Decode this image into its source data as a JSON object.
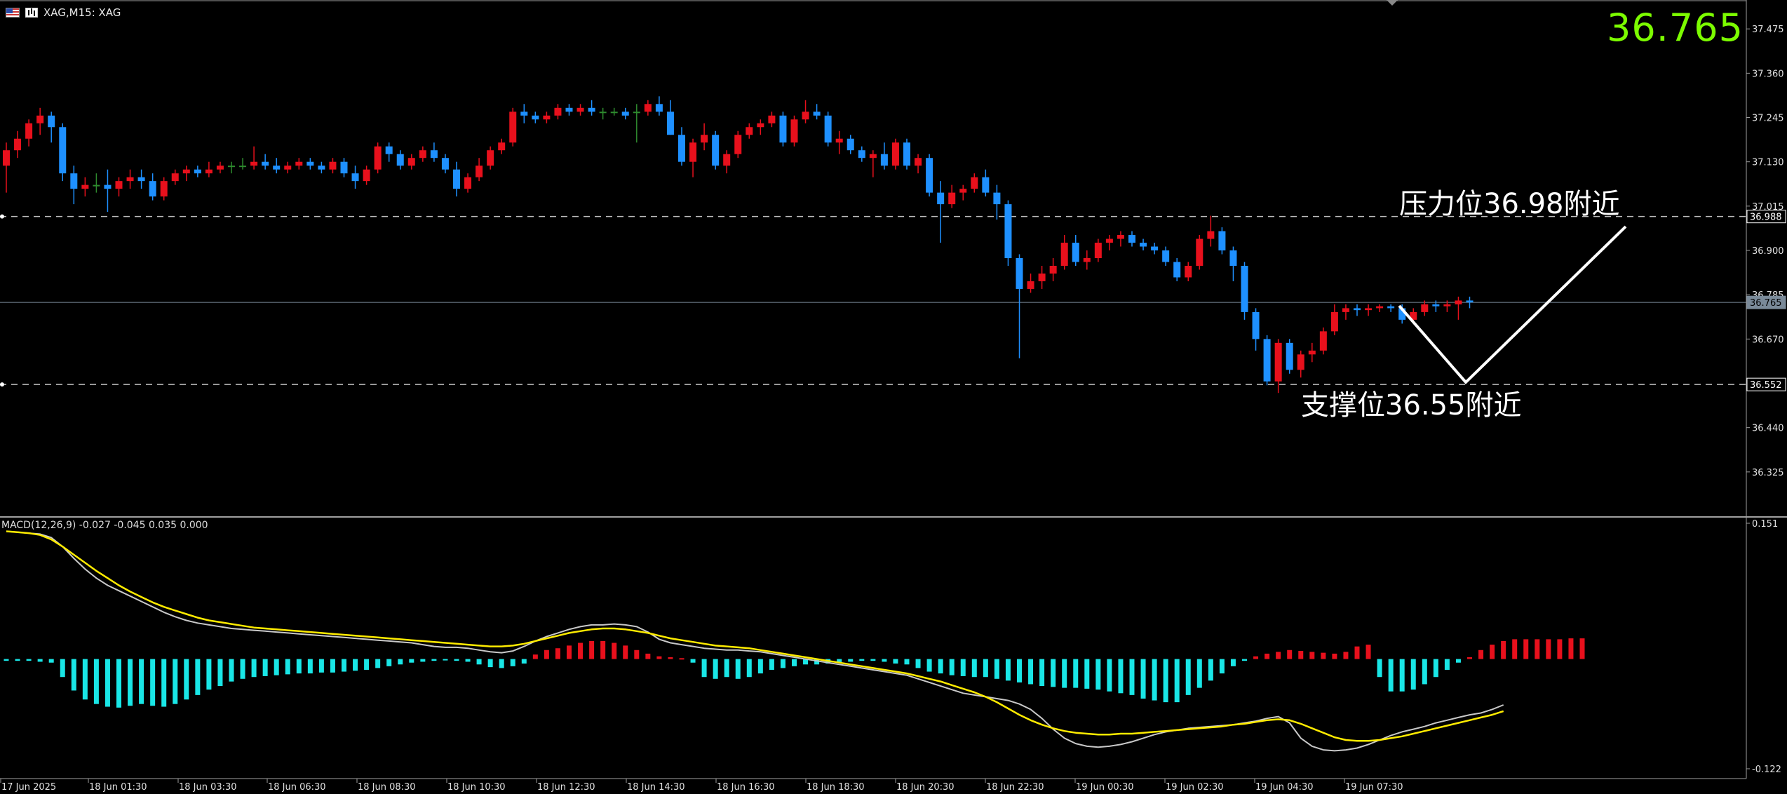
{
  "window": {
    "symbol_label": "XAG,M15:  XAG",
    "last_price": "36.765"
  },
  "annotations": {
    "resistance": "压力位36.98附近",
    "support": "支撑位36.55附近"
  },
  "colors": {
    "background": "#000000",
    "bull_candle": "#e8101c",
    "bear_candle": "#1e90ff",
    "neutral_candle": "#2e8b2e",
    "grid_dash": "#bfbfbf",
    "last_price_line": "#7a8a99",
    "macd_line": "#c8c8c8",
    "signal_line": "#ffeb00",
    "hist_positive": "#e8101c",
    "hist_negative": "#19e6e6",
    "last_price_text": "#7cfc00"
  },
  "chart_data": [
    {
      "type": "candlestick",
      "timeframe": "M15",
      "ylim": [
        36.21,
        37.55
      ],
      "y_ticks": [
        "37.475",
        "37.360",
        "37.245",
        "37.130",
        "37.015",
        "36.900",
        "36.785",
        "36.670",
        "36.555",
        "36.440",
        "36.325"
      ],
      "x_ticks": [
        "17 Jun 2025",
        "18 Jun 01:30",
        "18 Jun 03:30",
        "18 Jun 06:30",
        "18 Jun 08:30",
        "18 Jun 10:30",
        "18 Jun 12:30",
        "18 Jun 14:30",
        "18 Jun 16:30",
        "18 Jun 18:30",
        "18 Jun 20:30",
        "18 Jun 22:30",
        "19 Jun 00:30",
        "19 Jun 02:30",
        "19 Jun 04:30",
        "19 Jun 07:30"
      ],
      "price_labels": {
        "resistance": "36.988",
        "current": "36.765",
        "support": "36.552"
      },
      "levels": {
        "resistance": 36.988,
        "current": 36.765,
        "support": 36.552
      },
      "ohlc": [
        [
          37.12,
          37.18,
          37.05,
          37.16
        ],
        [
          37.16,
          37.21,
          37.14,
          37.19
        ],
        [
          37.19,
          37.24,
          37.17,
          37.23
        ],
        [
          37.23,
          37.27,
          37.2,
          37.25
        ],
        [
          37.25,
          37.26,
          37.18,
          37.22
        ],
        [
          37.22,
          37.23,
          37.08,
          37.1
        ],
        [
          37.1,
          37.12,
          37.02,
          37.06
        ],
        [
          37.06,
          37.09,
          37.04,
          37.07
        ],
        [
          37.07,
          37.1,
          37.05,
          37.07
        ],
        [
          37.07,
          37.11,
          37.0,
          37.06
        ],
        [
          37.06,
          37.09,
          37.04,
          37.08
        ],
        [
          37.08,
          37.11,
          37.06,
          37.09
        ],
        [
          37.09,
          37.11,
          37.06,
          37.08
        ],
        [
          37.08,
          37.1,
          37.03,
          37.04
        ],
        [
          37.04,
          37.09,
          37.03,
          37.08
        ],
        [
          37.08,
          37.11,
          37.07,
          37.1
        ],
        [
          37.1,
          37.12,
          37.08,
          37.11
        ],
        [
          37.11,
          37.12,
          37.09,
          37.1
        ],
        [
          37.1,
          37.13,
          37.09,
          37.11
        ],
        [
          37.11,
          37.13,
          37.1,
          37.12
        ],
        [
          37.12,
          37.13,
          37.1,
          37.12
        ],
        [
          37.12,
          37.14,
          37.11,
          37.12
        ],
        [
          37.12,
          37.17,
          37.11,
          37.13
        ],
        [
          37.13,
          37.15,
          37.11,
          37.12
        ],
        [
          37.12,
          37.14,
          37.1,
          37.11
        ],
        [
          37.11,
          37.13,
          37.1,
          37.12
        ],
        [
          37.12,
          37.14,
          37.11,
          37.13
        ],
        [
          37.13,
          37.14,
          37.11,
          37.12
        ],
        [
          37.12,
          37.13,
          37.1,
          37.11
        ],
        [
          37.11,
          37.14,
          37.1,
          37.13
        ],
        [
          37.13,
          37.14,
          37.09,
          37.1
        ],
        [
          37.1,
          37.12,
          37.06,
          37.08
        ],
        [
          37.08,
          37.12,
          37.07,
          37.11
        ],
        [
          37.11,
          37.18,
          37.1,
          37.17
        ],
        [
          37.17,
          37.18,
          37.13,
          37.15
        ],
        [
          37.15,
          37.16,
          37.11,
          37.12
        ],
        [
          37.12,
          37.15,
          37.11,
          37.14
        ],
        [
          37.14,
          37.17,
          37.13,
          37.16
        ],
        [
          37.16,
          37.18,
          37.13,
          37.14
        ],
        [
          37.14,
          37.15,
          37.1,
          37.11
        ],
        [
          37.11,
          37.13,
          37.04,
          37.06
        ],
        [
          37.06,
          37.1,
          37.05,
          37.09
        ],
        [
          37.09,
          37.14,
          37.08,
          37.12
        ],
        [
          37.12,
          37.17,
          37.11,
          37.16
        ],
        [
          37.16,
          37.19,
          37.15,
          37.18
        ],
        [
          37.18,
          37.27,
          37.17,
          37.26
        ],
        [
          37.26,
          37.28,
          37.23,
          37.25
        ],
        [
          37.25,
          37.26,
          37.23,
          37.24
        ],
        [
          37.24,
          37.26,
          37.23,
          37.25
        ],
        [
          37.25,
          37.28,
          37.24,
          37.27
        ],
        [
          37.27,
          37.28,
          37.25,
          37.26
        ],
        [
          37.26,
          37.28,
          37.25,
          37.27
        ],
        [
          37.27,
          37.29,
          37.25,
          37.26
        ],
        [
          37.26,
          37.27,
          37.24,
          37.26
        ],
        [
          37.26,
          37.27,
          37.25,
          37.26
        ],
        [
          37.26,
          37.27,
          37.24,
          37.25
        ],
        [
          37.26,
          37.28,
          37.18,
          37.26
        ],
        [
          37.26,
          37.29,
          37.25,
          37.28
        ],
        [
          37.28,
          37.3,
          37.25,
          37.26
        ],
        [
          37.26,
          37.29,
          37.2,
          37.2
        ],
        [
          37.2,
          37.22,
          37.12,
          37.13
        ],
        [
          37.13,
          37.19,
          37.09,
          37.18
        ],
        [
          37.18,
          37.23,
          37.16,
          37.2
        ],
        [
          37.2,
          37.21,
          37.11,
          37.12
        ],
        [
          37.12,
          37.16,
          37.1,
          37.15
        ],
        [
          37.15,
          37.21,
          37.14,
          37.2
        ],
        [
          37.2,
          37.23,
          37.19,
          37.22
        ],
        [
          37.22,
          37.24,
          37.2,
          37.23
        ],
        [
          37.23,
          37.26,
          37.22,
          37.25
        ],
        [
          37.25,
          37.26,
          37.17,
          37.18
        ],
        [
          37.18,
          37.25,
          37.17,
          37.24
        ],
        [
          37.24,
          37.29,
          37.23,
          37.26
        ],
        [
          37.26,
          37.28,
          37.24,
          37.25
        ],
        [
          37.25,
          37.26,
          37.17,
          37.18
        ],
        [
          37.18,
          37.21,
          37.15,
          37.19
        ],
        [
          37.19,
          37.2,
          37.15,
          37.16
        ],
        [
          37.16,
          37.17,
          37.13,
          37.14
        ],
        [
          37.14,
          37.16,
          37.09,
          37.15
        ],
        [
          37.15,
          37.18,
          37.11,
          37.12
        ],
        [
          37.12,
          37.19,
          37.11,
          37.18
        ],
        [
          37.18,
          37.19,
          37.11,
          37.12
        ],
        [
          37.12,
          37.15,
          37.1,
          37.14
        ],
        [
          37.14,
          37.15,
          37.04,
          37.05
        ],
        [
          37.05,
          37.08,
          36.92,
          37.02
        ],
        [
          37.02,
          37.07,
          37.01,
          37.05
        ],
        [
          37.05,
          37.07,
          37.03,
          37.06
        ],
        [
          37.06,
          37.1,
          37.05,
          37.09
        ],
        [
          37.09,
          37.11,
          37.04,
          37.05
        ],
        [
          37.05,
          37.07,
          36.98,
          37.02
        ],
        [
          37.02,
          37.03,
          36.86,
          36.88
        ],
        [
          36.88,
          36.89,
          36.62,
          36.8
        ],
        [
          36.8,
          36.84,
          36.79,
          36.82
        ],
        [
          36.82,
          36.86,
          36.8,
          36.84
        ],
        [
          36.84,
          36.88,
          36.82,
          36.86
        ],
        [
          36.86,
          36.94,
          36.85,
          36.92
        ],
        [
          36.92,
          36.94,
          36.86,
          36.87
        ],
        [
          36.87,
          36.9,
          36.85,
          36.88
        ],
        [
          36.88,
          36.93,
          36.87,
          36.92
        ],
        [
          36.92,
          36.94,
          36.9,
          36.93
        ],
        [
          36.93,
          36.95,
          36.91,
          36.94
        ],
        [
          36.94,
          36.95,
          36.91,
          36.92
        ],
        [
          36.92,
          36.93,
          36.9,
          36.91
        ],
        [
          36.91,
          36.92,
          36.89,
          36.9
        ],
        [
          36.9,
          36.91,
          36.86,
          36.87
        ],
        [
          36.87,
          36.88,
          36.82,
          36.83
        ],
        [
          36.83,
          36.87,
          36.82,
          36.86
        ],
        [
          36.86,
          36.94,
          36.85,
          36.93
        ],
        [
          36.93,
          36.99,
          36.91,
          36.95
        ],
        [
          36.95,
          36.96,
          36.89,
          36.9
        ],
        [
          36.9,
          36.91,
          36.82,
          36.86
        ],
        [
          36.86,
          36.87,
          36.72,
          36.74
        ],
        [
          36.74,
          36.75,
          36.64,
          36.67
        ],
        [
          36.67,
          36.68,
          36.55,
          36.56
        ],
        [
          36.56,
          36.67,
          36.53,
          36.66
        ],
        [
          36.66,
          36.67,
          36.58,
          36.59
        ],
        [
          36.59,
          36.64,
          36.57,
          36.63
        ],
        [
          36.63,
          36.66,
          36.61,
          36.64
        ],
        [
          36.64,
          36.7,
          36.63,
          36.69
        ],
        [
          36.69,
          36.76,
          36.68,
          36.74
        ],
        [
          36.74,
          36.76,
          36.72,
          36.75
        ],
        [
          36.75,
          36.76,
          36.73,
          36.745
        ],
        [
          36.745,
          36.76,
          36.73,
          36.75
        ],
        [
          36.75,
          36.76,
          36.74,
          36.755
        ],
        [
          36.755,
          36.76,
          36.74,
          36.75
        ],
        [
          36.75,
          36.76,
          36.71,
          36.72
        ],
        [
          36.72,
          36.75,
          36.71,
          36.74
        ],
        [
          36.74,
          36.77,
          36.73,
          36.76
        ],
        [
          36.76,
          36.77,
          36.74,
          36.755
        ],
        [
          36.755,
          36.77,
          36.74,
          36.76
        ],
        [
          36.76,
          36.78,
          36.72,
          36.77
        ],
        [
          36.77,
          36.78,
          36.75,
          36.765
        ]
      ]
    },
    {
      "type": "macd",
      "label": "MACD(12,26,9) -0.027 -0.045 0.035 0.000",
      "ylim": [
        -0.122,
        0.151
      ],
      "y_ticks": [
        "0.151",
        "-0.122"
      ],
      "histogram": [
        -0.002,
        -0.002,
        -0.002,
        -0.003,
        -0.004,
        -0.02,
        -0.035,
        -0.045,
        -0.05,
        -0.053,
        -0.054,
        -0.052,
        -0.05,
        -0.052,
        -0.053,
        -0.05,
        -0.045,
        -0.04,
        -0.034,
        -0.03,
        -0.025,
        -0.022,
        -0.02,
        -0.019,
        -0.018,
        -0.017,
        -0.016,
        -0.016,
        -0.015,
        -0.015,
        -0.014,
        -0.013,
        -0.012,
        -0.01,
        -0.008,
        -0.006,
        -0.004,
        -0.003,
        -0.002,
        -0.001,
        -0.002,
        -0.003,
        -0.006,
        -0.009,
        -0.01,
        -0.008,
        -0.005,
        0.005,
        0.01,
        0.012,
        0.015,
        0.018,
        0.02,
        0.02,
        0.018,
        0.015,
        0.01,
        0.006,
        0.003,
        0.002,
        0.001,
        -0.004,
        -0.02,
        -0.022,
        -0.02,
        -0.022,
        -0.02,
        -0.016,
        -0.012,
        -0.01,
        -0.008,
        -0.006,
        -0.006,
        -0.005,
        -0.004,
        -0.003,
        -0.002,
        -0.002,
        -0.003,
        -0.005,
        -0.006,
        -0.01,
        -0.014,
        -0.016,
        -0.018,
        -0.019,
        -0.02,
        -0.02,
        -0.022,
        -0.024,
        -0.026,
        -0.028,
        -0.03,
        -0.031,
        -0.032,
        -0.032,
        -0.033,
        -0.034,
        -0.036,
        -0.038,
        -0.04,
        -0.044,
        -0.046,
        -0.048,
        -0.048,
        -0.04,
        -0.032,
        -0.024,
        -0.016,
        -0.008,
        -0.002,
        0.003,
        0.006,
        0.008,
        0.01,
        0.009,
        0.008,
        0.007,
        0.006,
        0.008,
        0.014,
        0.016,
        -0.02,
        -0.036,
        -0.036,
        -0.034,
        -0.028,
        -0.02,
        -0.012,
        -0.004,
        0.002,
        0.01,
        0.016,
        0.02,
        0.022,
        0.022,
        0.022,
        0.022,
        0.022,
        0.023,
        0.023
      ],
      "macd": [
        0.142,
        0.141,
        0.14,
        0.139,
        0.135,
        0.125,
        0.112,
        0.1,
        0.09,
        0.082,
        0.076,
        0.07,
        0.064,
        0.058,
        0.052,
        0.047,
        0.043,
        0.04,
        0.038,
        0.036,
        0.034,
        0.033,
        0.032,
        0.031,
        0.03,
        0.029,
        0.028,
        0.027,
        0.026,
        0.025,
        0.024,
        0.023,
        0.022,
        0.021,
        0.02,
        0.019,
        0.018,
        0.016,
        0.014,
        0.013,
        0.013,
        0.012,
        0.01,
        0.008,
        0.007,
        0.009,
        0.014,
        0.02,
        0.025,
        0.029,
        0.033,
        0.036,
        0.038,
        0.038,
        0.039,
        0.038,
        0.036,
        0.03,
        0.022,
        0.018,
        0.016,
        0.014,
        0.012,
        0.011,
        0.01,
        0.01,
        0.009,
        0.008,
        0.006,
        0.004,
        0.002,
        0.0,
        -0.002,
        -0.004,
        -0.006,
        -0.008,
        -0.01,
        -0.012,
        -0.014,
        -0.016,
        -0.018,
        -0.022,
        -0.026,
        -0.03,
        -0.034,
        -0.038,
        -0.04,
        -0.042,
        -0.044,
        -0.046,
        -0.05,
        -0.056,
        -0.066,
        -0.078,
        -0.088,
        -0.094,
        -0.097,
        -0.098,
        -0.097,
        -0.095,
        -0.092,
        -0.088,
        -0.084,
        -0.081,
        -0.079,
        -0.077,
        -0.076,
        -0.075,
        -0.074,
        -0.073,
        -0.071,
        -0.069,
        -0.066,
        -0.064,
        -0.071,
        -0.088,
        -0.097,
        -0.101,
        -0.102,
        -0.101,
        -0.099,
        -0.095,
        -0.09,
        -0.085,
        -0.081,
        -0.078,
        -0.075,
        -0.071,
        -0.068,
        -0.065,
        -0.062,
        -0.06,
        -0.056,
        -0.051
      ],
      "signal": [
        0.142,
        0.141,
        0.14,
        0.138,
        0.133,
        0.125,
        0.116,
        0.107,
        0.098,
        0.09,
        0.082,
        0.075,
        0.069,
        0.063,
        0.058,
        0.054,
        0.05,
        0.046,
        0.043,
        0.041,
        0.039,
        0.037,
        0.035,
        0.034,
        0.033,
        0.032,
        0.031,
        0.03,
        0.029,
        0.028,
        0.027,
        0.026,
        0.025,
        0.024,
        0.023,
        0.022,
        0.021,
        0.02,
        0.019,
        0.018,
        0.017,
        0.016,
        0.015,
        0.014,
        0.014,
        0.015,
        0.017,
        0.02,
        0.023,
        0.026,
        0.029,
        0.031,
        0.033,
        0.034,
        0.034,
        0.033,
        0.031,
        0.029,
        0.026,
        0.023,
        0.021,
        0.019,
        0.017,
        0.015,
        0.014,
        0.013,
        0.012,
        0.01,
        0.008,
        0.006,
        0.004,
        0.002,
        0.0,
        -0.002,
        -0.004,
        -0.006,
        -0.008,
        -0.01,
        -0.012,
        -0.014,
        -0.016,
        -0.019,
        -0.022,
        -0.025,
        -0.029,
        -0.033,
        -0.037,
        -0.042,
        -0.048,
        -0.055,
        -0.062,
        -0.068,
        -0.073,
        -0.077,
        -0.08,
        -0.082,
        -0.083,
        -0.084,
        -0.084,
        -0.083,
        -0.083,
        -0.082,
        -0.081,
        -0.08,
        -0.079,
        -0.078,
        -0.077,
        -0.076,
        -0.075,
        -0.073,
        -0.072,
        -0.07,
        -0.068,
        -0.067,
        -0.068,
        -0.072,
        -0.077,
        -0.082,
        -0.087,
        -0.09,
        -0.091,
        -0.091,
        -0.09,
        -0.088,
        -0.086,
        -0.083,
        -0.08,
        -0.077,
        -0.074,
        -0.071,
        -0.068,
        -0.065,
        -0.062,
        -0.058
      ]
    }
  ]
}
